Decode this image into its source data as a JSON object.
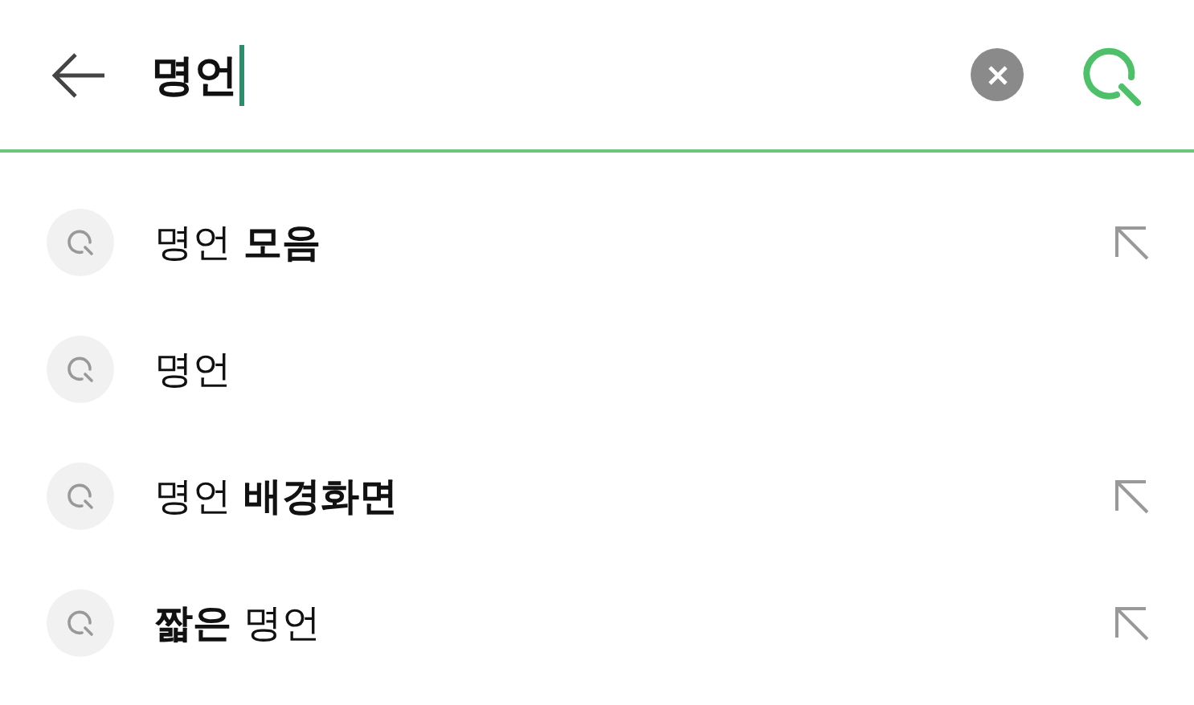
{
  "search": {
    "value": "명언"
  },
  "suggestions": [
    {
      "text": "명언 **모음**",
      "fill_arrow": true
    },
    {
      "text": "명언",
      "fill_arrow": false
    },
    {
      "text": "명언 **배경화면**",
      "fill_arrow": true
    },
    {
      "text": "**짧은** 명언",
      "fill_arrow": true
    }
  ]
}
